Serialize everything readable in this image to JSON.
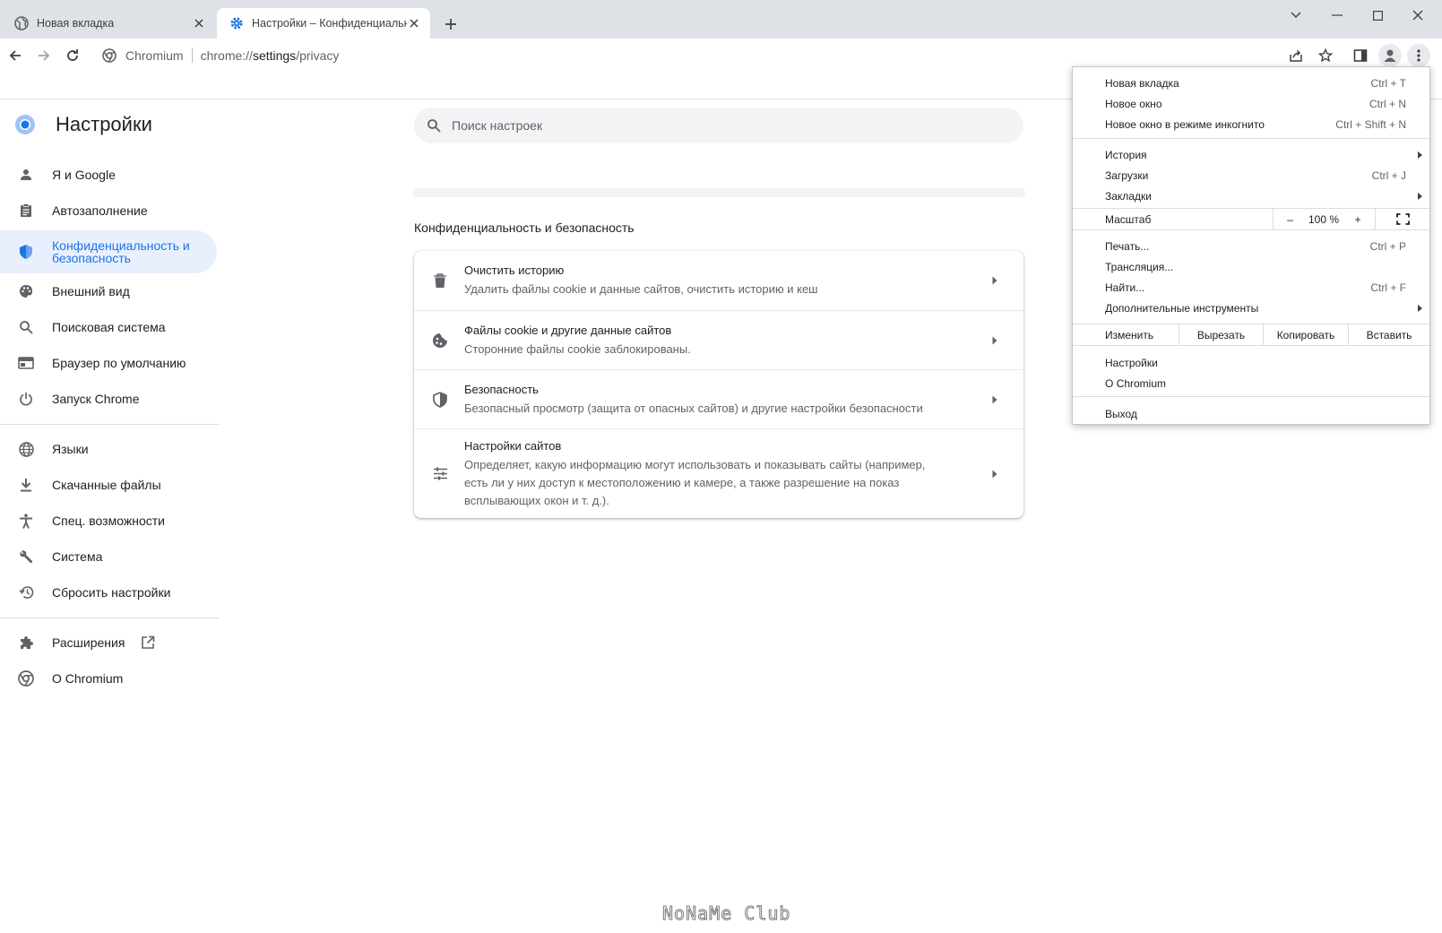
{
  "tabs": [
    {
      "title": "Новая вкладка"
    },
    {
      "title": "Настройки – Конфиденциальность и безопасность"
    }
  ],
  "omnibox": {
    "site": "Chromium",
    "url_prefix": "chrome://",
    "url_path": "settings",
    "url_suffix": "/privacy"
  },
  "settings": {
    "title": "Настройки",
    "search_placeholder": "Поиск настроек",
    "nav": [
      {
        "label": "Я и Google",
        "icon": "person-icon"
      },
      {
        "label": "Автозаполнение",
        "icon": "clipboard-icon"
      },
      {
        "label": "Конфиденциальность и\nбезопасность",
        "icon": "shield-icon"
      },
      {
        "label": "Внешний вид",
        "icon": "palette-icon"
      },
      {
        "label": "Поисковая система",
        "icon": "search-icon"
      },
      {
        "label": "Браузер по умолчанию",
        "icon": "browser-icon"
      },
      {
        "label": "Запуск Chrome",
        "icon": "power-icon"
      },
      {
        "label": "Языки",
        "icon": "globe-icon"
      },
      {
        "label": "Скачанные файлы",
        "icon": "download-icon"
      },
      {
        "label": "Спец. возможности",
        "icon": "accessibility-icon"
      },
      {
        "label": "Система",
        "icon": "wrench-icon"
      },
      {
        "label": "Сбросить настройки",
        "icon": "restore-icon"
      },
      {
        "label": "Расширения",
        "icon": "puzzle-icon"
      },
      {
        "label": "О Chromium",
        "icon": "chromium-icon"
      }
    ],
    "section_title": "Конфиденциальность и безопасность",
    "rows": [
      {
        "title": "Очистить историю",
        "subtitle": "Удалить файлы cookie и данные сайтов, очистить историю и кеш",
        "icon": "trash-icon"
      },
      {
        "title": "Файлы cookie и другие данные сайтов",
        "subtitle": "Сторонние файлы cookie заблокированы.",
        "icon": "cookie-icon"
      },
      {
        "title": "Безопасность",
        "subtitle": "Безопасный просмотр (защита от опасных сайтов) и другие настройки безопасности",
        "icon": "security-shield-icon"
      },
      {
        "title": "Настройки сайтов",
        "subtitle": "Определяет, какую информацию могут использовать и показывать сайты (например, есть ли у них доступ к местоположению и камере, а также разрешение на показ всплывающих окон и т. д.).",
        "icon": "tune-icon"
      }
    ]
  },
  "menu": {
    "new_tab": {
      "label": "Новая вкладка",
      "shortcut": "Ctrl + T"
    },
    "new_window": {
      "label": "Новое окно",
      "shortcut": "Ctrl + N"
    },
    "incognito": {
      "label": "Новое окно в режиме инкогнито",
      "shortcut": "Ctrl + Shift + N"
    },
    "history": {
      "label": "История"
    },
    "downloads": {
      "label": "Загрузки",
      "shortcut": "Ctrl + J"
    },
    "bookmarks": {
      "label": "Закладки"
    },
    "zoom": {
      "label": "Масштаб",
      "minus": "–",
      "value": "100 %",
      "plus": "+"
    },
    "print": {
      "label": "Печать...",
      "shortcut": "Ctrl + P"
    },
    "cast": {
      "label": "Трансляция..."
    },
    "find": {
      "label": "Найти...",
      "shortcut": "Ctrl + F"
    },
    "more_tools": {
      "label": "Дополнительные инструменты"
    },
    "edit": {
      "label": "Изменить",
      "cut": "Вырезать",
      "copy": "Копировать",
      "paste": "Вставить"
    },
    "settings": {
      "label": "Настройки"
    },
    "about": {
      "label": "О Chromium"
    },
    "exit": {
      "label": "Выход"
    }
  },
  "watermark": "NoNaMe Club",
  "colors": {
    "accent": "#1a73e8",
    "active_nav_bg": "#e8f0fe",
    "tabstrip_bg": "#dee1e6"
  }
}
